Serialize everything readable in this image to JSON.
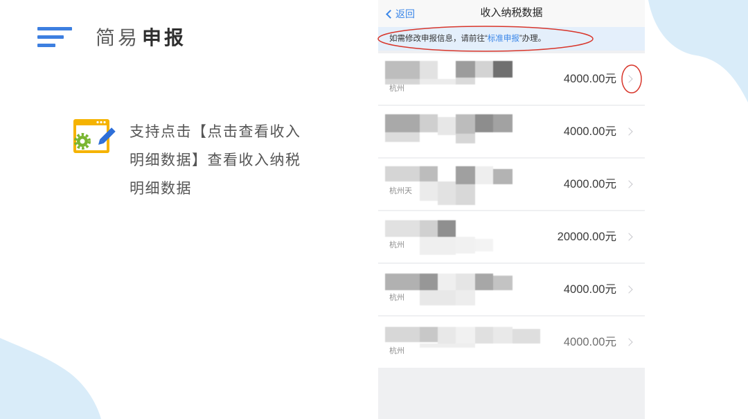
{
  "slide": {
    "menu_icon": "menu-lines-icon",
    "title_light": "简易",
    "title_bold": "申报",
    "feature_icon": "window-gear-pencil-icon",
    "description_lines": [
      "支持点击【点击查看收入",
      "明细数据】查看收入纳税",
      "明细数据"
    ]
  },
  "phone": {
    "nav": {
      "back_icon": "chevron-left-icon",
      "back_label": "返回",
      "title": "收入纳税数据"
    },
    "notice": {
      "prefix": "如需修改申报信息，请前往“",
      "link": "标准申报",
      "suffix": "”办理。"
    },
    "row_icon": "chevron-right-icon",
    "records": [
      {
        "sub_label": "杭州",
        "amount": "4000.00元"
      },
      {
        "amount": "4000.00元"
      },
      {
        "sub_label": "杭州天",
        "amount": "4000.00元"
      },
      {
        "sub_label": "杭州",
        "amount": "20000.00元"
      },
      {
        "sub_label": "杭州",
        "amount": "4000.00元"
      },
      {
        "sub_label": "杭州",
        "amount": "4000.00元"
      }
    ]
  },
  "colors": {
    "accent": "#3d7fe0",
    "link": "#3a86e8",
    "annotation": "#d8352a",
    "blob": "#d9ecf9",
    "notice_bg": "#e4effb"
  }
}
